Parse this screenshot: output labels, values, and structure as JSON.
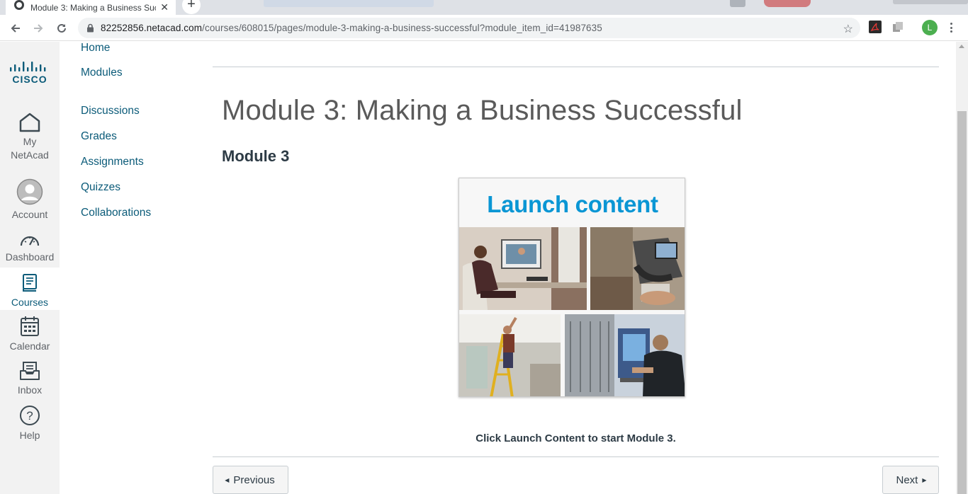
{
  "browser": {
    "tab_title": "Module 3: Making a Business Successful",
    "tab_close": "✕",
    "new_tab": "+",
    "url_host": "82252856.netacad.com",
    "url_path": "/courses/608015/pages/module-3-making-a-business-successful?module_item_id=41987635",
    "profile_initial": "L"
  },
  "global_nav": {
    "items": [
      {
        "label": "My NetAcad",
        "icon": "home-icon"
      },
      {
        "label": "Account",
        "icon": "account-icon"
      },
      {
        "label": "Dashboard",
        "icon": "dashboard-icon"
      },
      {
        "label": "Courses",
        "icon": "courses-icon",
        "active": true
      },
      {
        "label": "Calendar",
        "icon": "calendar-icon"
      },
      {
        "label": "Inbox",
        "icon": "inbox-icon"
      },
      {
        "label": "Help",
        "icon": "help-icon"
      }
    ]
  },
  "course_nav": {
    "items": [
      "Home",
      "Modules",
      "Discussions",
      "Grades",
      "Assignments",
      "Quizzes",
      "Collaborations"
    ]
  },
  "main": {
    "title": "Module 3: Making a Business Successful",
    "heading": "Module 3",
    "launch_label": "Launch content",
    "instruction": "Click Launch Content to start Module 3."
  },
  "pager": {
    "previous": "Previous",
    "next": "Next"
  },
  "colors": {
    "link": "#0b5b79",
    "launch_text": "#0a96d4",
    "rail_bg": "#f2f2f2"
  }
}
